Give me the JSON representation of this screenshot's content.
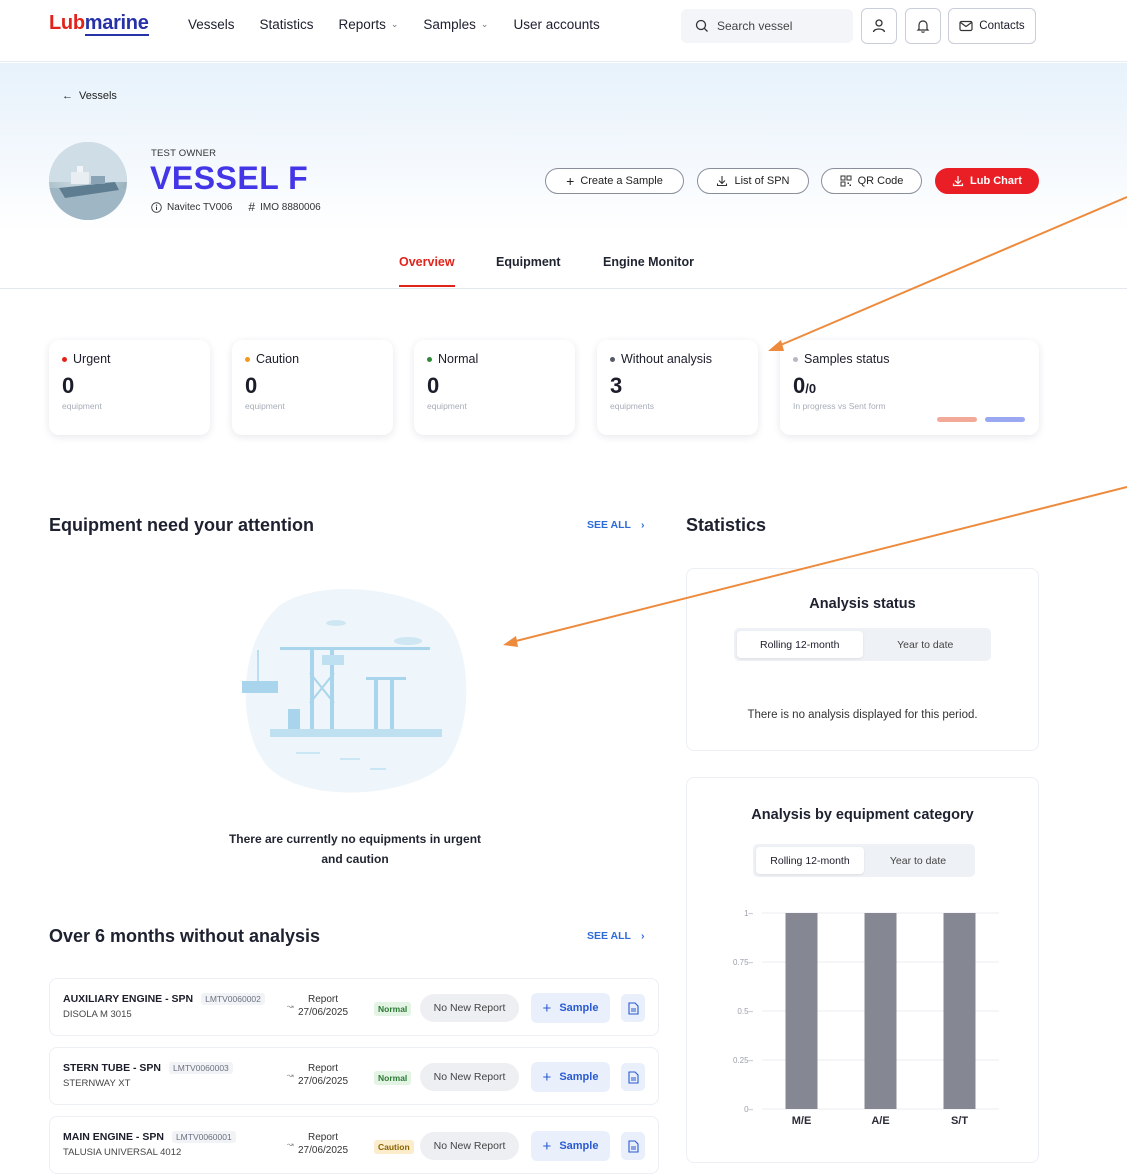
{
  "brand": {
    "logo_part1": "Lub",
    "logo_part2": "marine"
  },
  "nav": {
    "links": [
      "Vessels",
      "Statistics",
      "Reports",
      "Samples",
      "User accounts"
    ],
    "search_placeholder": "Search vessel",
    "contacts_label": "Contacts"
  },
  "header": {
    "back_label": "Vessels",
    "owner": "TEST OWNER",
    "vessel_name": "VESSEL F",
    "navitec": "Navitec TV006",
    "imo": "IMO 8880006",
    "actions": [
      "Create a Sample",
      "List of SPN",
      "QR Code",
      "Lub Chart"
    ],
    "tabs": [
      "Overview",
      "Equipment",
      "Engine Monitor"
    ],
    "active_tab": "Overview"
  },
  "status_cards": [
    {
      "label": "Urgent",
      "value": "0",
      "sub": "equipment",
      "color": "#e1241b"
    },
    {
      "label": "Caution",
      "value": "0",
      "sub": "equipment",
      "color": "#f39a1c"
    },
    {
      "label": "Normal",
      "value": "0",
      "sub": "equipment",
      "color": "#2e8b3a"
    },
    {
      "label": "Without analysis",
      "value": "3",
      "sub": "equipments",
      "color": "#555b66"
    },
    {
      "label": "Samples status",
      "value": "0",
      "value_suffix": "/0",
      "sub": "In progress vs Sent form",
      "color": "#b5b9c2"
    }
  ],
  "attention": {
    "title": "Equipment need your attention",
    "see_all": "SEE ALL",
    "empty_line1": "There are currently no equipments in urgent",
    "empty_line2": "and caution"
  },
  "over6": {
    "title": "Over 6 months without analysis",
    "see_all": "SEE ALL",
    "rows": [
      {
        "name": "AUXILIARY ENGINE - SPN",
        "code": "LMTV0060002",
        "oil": "DISOLA M 3015",
        "report_label": "Report",
        "report_date": "27/06/2025",
        "status": "Normal",
        "report_state": "No New Report",
        "sample_label": "Sample"
      },
      {
        "name": "STERN TUBE - SPN",
        "code": "LMTV0060003",
        "oil": "STERNWAY XT",
        "report_label": "Report",
        "report_date": "27/06/2025",
        "status": "Normal",
        "report_state": "No New Report",
        "sample_label": "Sample"
      },
      {
        "name": "MAIN ENGINE - SPN",
        "code": "LMTV0060001",
        "oil": "TALUSIA UNIVERSAL 4012",
        "report_label": "Report",
        "report_date": "27/06/2025",
        "status": "Caution",
        "report_state": "No New Report",
        "sample_label": "Sample"
      }
    ]
  },
  "statistics": {
    "title": "Statistics",
    "analysis_status": {
      "title": "Analysis status",
      "segments": [
        "Rolling 12-month",
        "Year to date"
      ],
      "empty_text": "There is no analysis displayed for this period."
    },
    "by_category": {
      "title": "Analysis by equipment category",
      "segments": [
        "Rolling 12-month",
        "Year to date"
      ]
    }
  },
  "chart_data": {
    "type": "bar",
    "title": "Analysis by equipment category",
    "categories": [
      "M/E",
      "A/E",
      "S/T"
    ],
    "values": [
      1,
      1,
      1
    ],
    "ylim": [
      0,
      1
    ],
    "yticks": [
      "0",
      "0.25",
      "0.5",
      "0.75",
      "1"
    ],
    "bar_color": "#858892",
    "grid": true
  }
}
